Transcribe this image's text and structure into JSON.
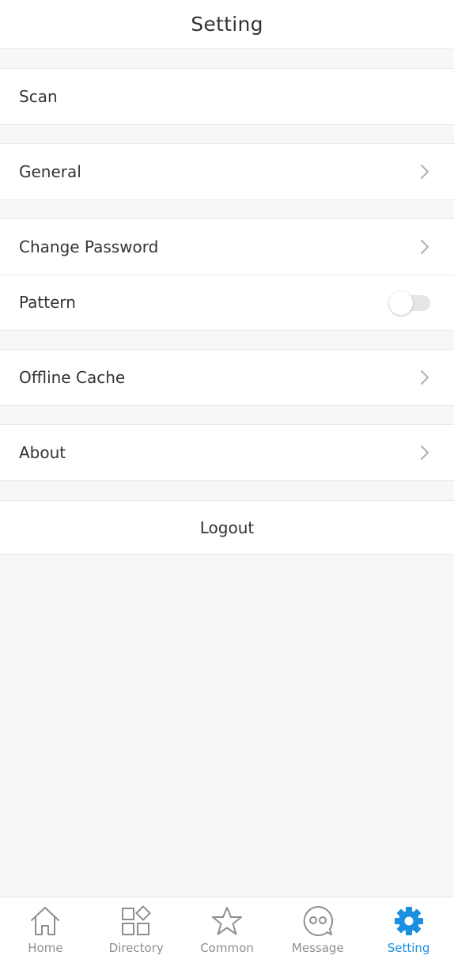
{
  "header": {
    "title": "Setting"
  },
  "groups": {
    "scan": {
      "label": "Scan"
    },
    "general": {
      "label": "General"
    },
    "security": {
      "change_password": "Change Password",
      "pattern": "Pattern",
      "pattern_enabled": false
    },
    "offline_cache": {
      "label": "Offline Cache"
    },
    "about": {
      "label": "About"
    }
  },
  "logout": {
    "label": "Logout"
  },
  "tabbar": {
    "active": "Setting",
    "active_color": "#1b8fe0",
    "inactive_color": "#8e8e8e",
    "items": [
      {
        "label": "Home",
        "icon": "home-icon"
      },
      {
        "label": "Directory",
        "icon": "directory-icon"
      },
      {
        "label": "Common",
        "icon": "star-icon"
      },
      {
        "label": "Message",
        "icon": "message-icon"
      },
      {
        "label": "Setting",
        "icon": "gear-icon"
      }
    ]
  }
}
